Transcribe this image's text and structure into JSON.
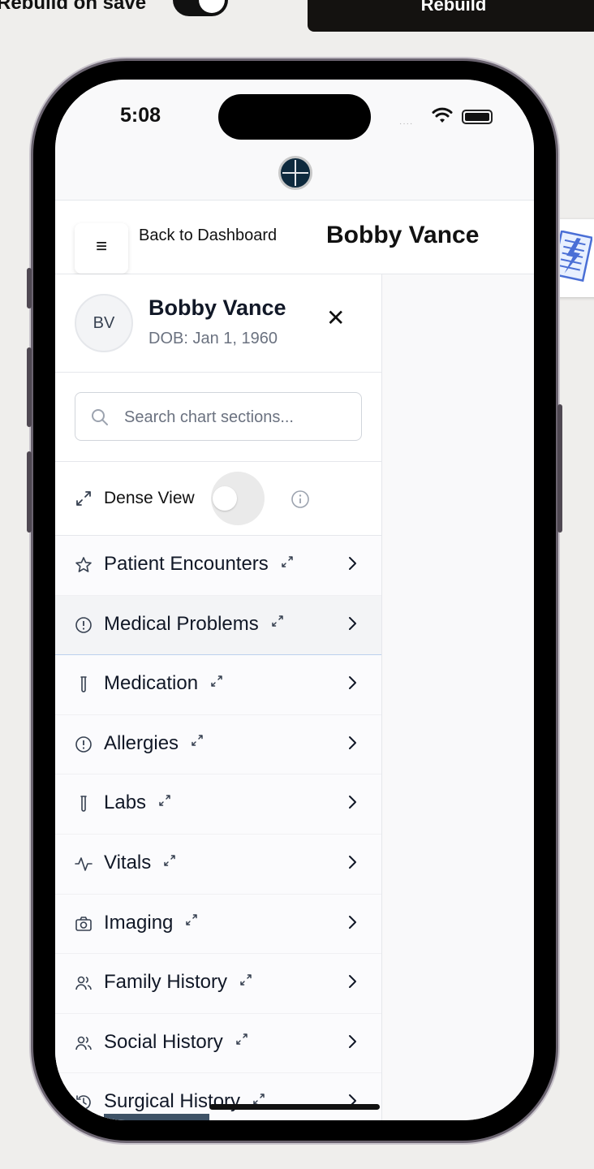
{
  "toolbar": {
    "rebuild_on_save_label": "Rebuild on save",
    "rebuild_on_save_enabled": true,
    "rebuild_button": "Rebuild"
  },
  "status_bar": {
    "time": "5:08",
    "signal": "····"
  },
  "header": {
    "menu_icon": "≡",
    "back_link": "Back to Dashboard",
    "title": "Bobby Vance"
  },
  "patient": {
    "initials": "BV",
    "name": "Bobby Vance",
    "dob": "DOB: Jan 1, 1960",
    "close_icon": "✕"
  },
  "search": {
    "placeholder": "Search chart sections..."
  },
  "dense_view": {
    "label": "Dense View",
    "enabled": false
  },
  "nav": {
    "items": [
      {
        "label": "Patient Encounters",
        "icon": "star-icon"
      },
      {
        "label": "Medical Problems",
        "icon": "alert-circle-icon",
        "active": true
      },
      {
        "label": "Medication",
        "icon": "test-tube-icon"
      },
      {
        "label": "Allergies",
        "icon": "alert-circle-icon"
      },
      {
        "label": "Labs",
        "icon": "test-tube-icon"
      },
      {
        "label": "Vitals",
        "icon": "activity-icon"
      },
      {
        "label": "Imaging",
        "icon": "camera-icon"
      },
      {
        "label": "Family History",
        "icon": "users-icon"
      },
      {
        "label": "Social History",
        "icon": "users-icon"
      },
      {
        "label": "Surgical History",
        "icon": "history-icon"
      }
    ]
  }
}
